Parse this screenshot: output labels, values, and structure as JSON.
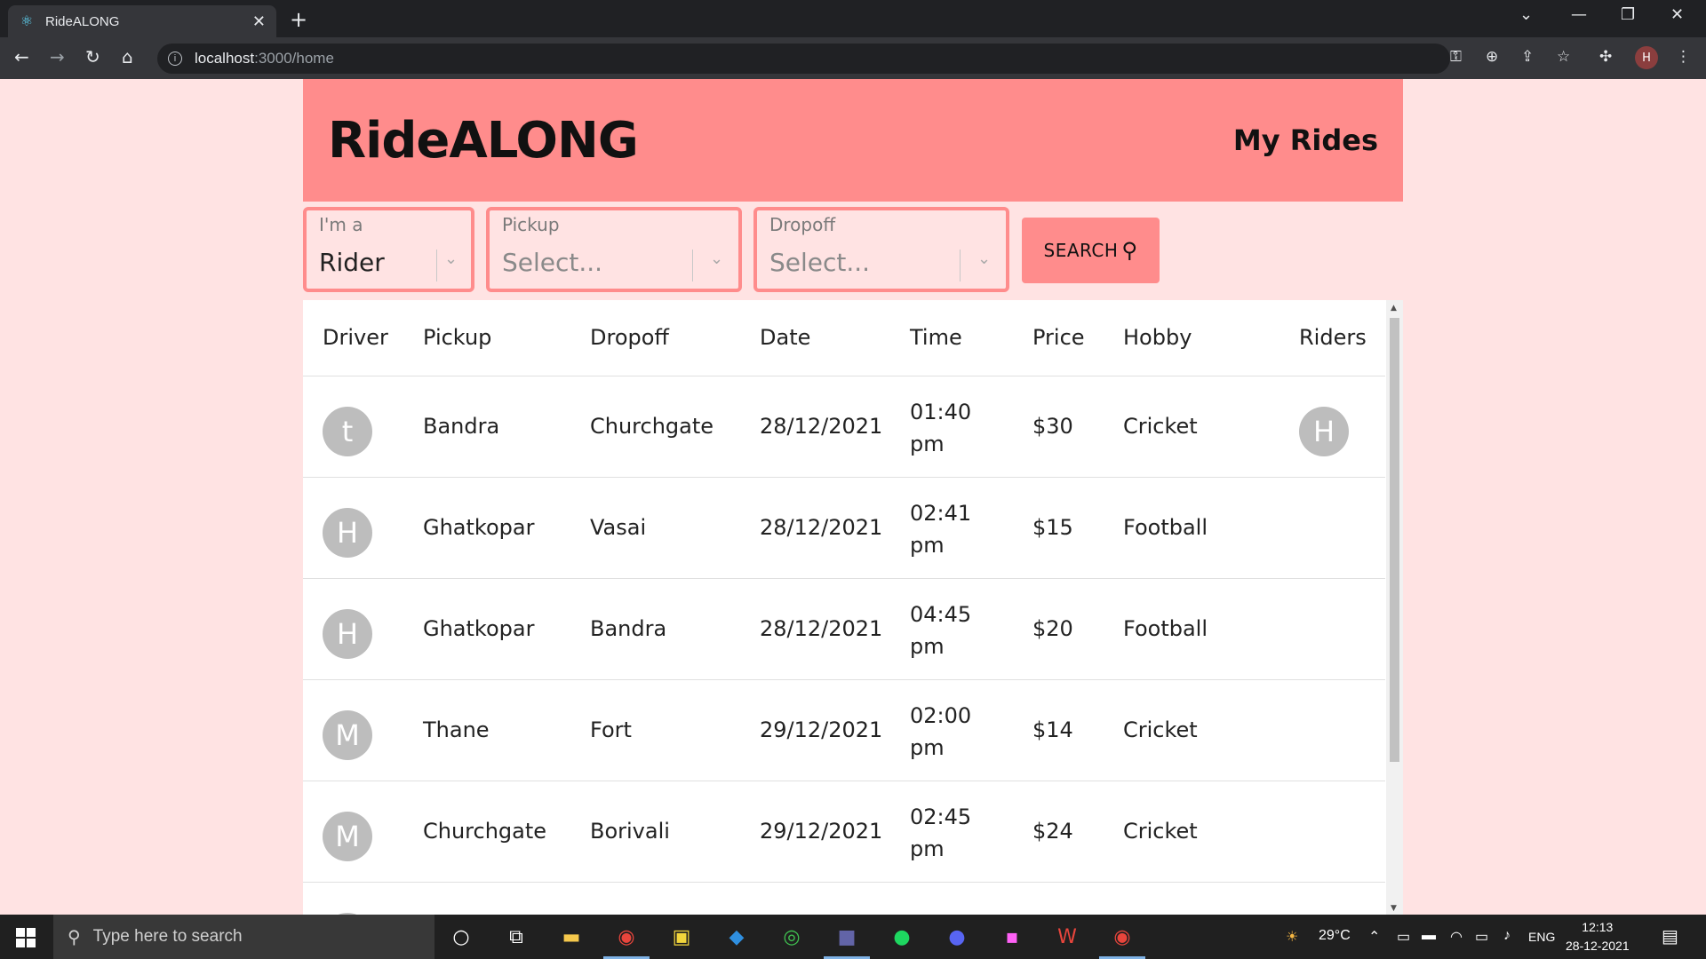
{
  "browser": {
    "tab_title": "RideALONG",
    "url_host": "localhost",
    "url_path": ":3000/home"
  },
  "header": {
    "brand": "RideALONG",
    "my_rides": "My Rides"
  },
  "filters": {
    "role": {
      "label": "I'm a",
      "value": "Rider"
    },
    "pickup": {
      "label": "Pickup",
      "value": "Select..."
    },
    "dropoff": {
      "label": "Dropoff",
      "value": "Select..."
    },
    "search_label": "SEARCH"
  },
  "table": {
    "columns": [
      "Driver",
      "Pickup",
      "Dropoff",
      "Date",
      "Time",
      "Price",
      "Hobby",
      "Riders"
    ],
    "rows": [
      {
        "driver": "t",
        "pickup": "Bandra",
        "dropoff": "Churchgate",
        "date": "28/12/2021",
        "time_1": "01:40",
        "time_2": "pm",
        "price": "$30",
        "hobby": "Cricket",
        "rider": "H"
      },
      {
        "driver": "H",
        "pickup": "Ghatkopar",
        "dropoff": "Vasai",
        "date": "28/12/2021",
        "time_1": "02:41",
        "time_2": "pm",
        "price": "$15",
        "hobby": "Football",
        "rider": ""
      },
      {
        "driver": "H",
        "pickup": "Ghatkopar",
        "dropoff": "Bandra",
        "date": "28/12/2021",
        "time_1": "04:45",
        "time_2": "pm",
        "price": "$20",
        "hobby": "Football",
        "rider": ""
      },
      {
        "driver": "M",
        "pickup": "Thane",
        "dropoff": "Fort",
        "date": "29/12/2021",
        "time_1": "02:00",
        "time_2": "pm",
        "price": "$14",
        "hobby": "Cricket",
        "rider": ""
      },
      {
        "driver": "M",
        "pickup": "Churchgate",
        "dropoff": "Borivali",
        "date": "29/12/2021",
        "time_1": "02:45",
        "time_2": "pm",
        "price": "$24",
        "hobby": "Cricket",
        "rider": ""
      }
    ]
  },
  "taskbar": {
    "search_placeholder": "Type here to search",
    "weather": "29°C",
    "language": "ENG",
    "time": "12:13",
    "date": "28-12-2021"
  },
  "colors": {
    "accent": "#ff8c8c",
    "page_bg": "#ffe3e3"
  }
}
